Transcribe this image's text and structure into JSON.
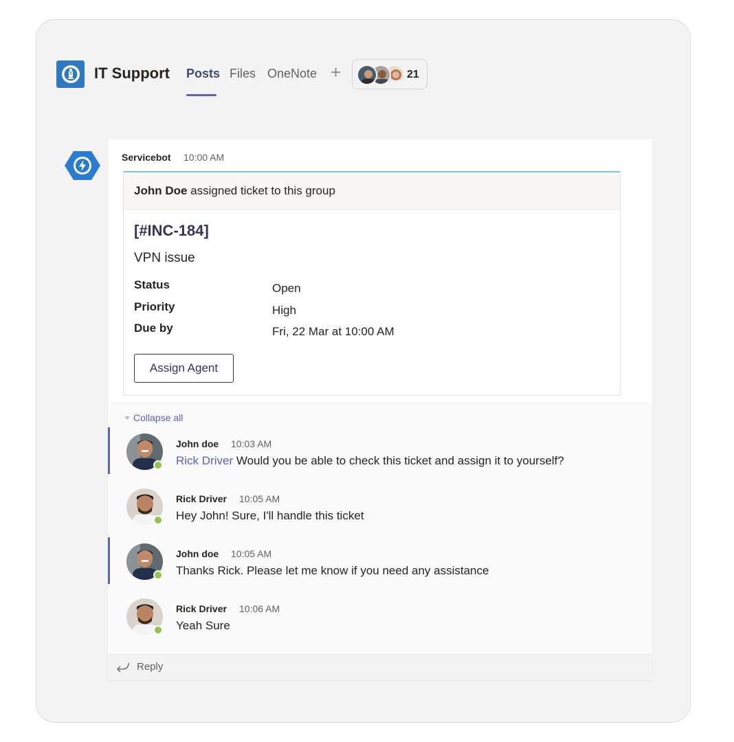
{
  "header": {
    "team_name": "IT Support",
    "tabs": [
      "Posts",
      "Files",
      "OneNote"
    ],
    "active_tab": "Posts",
    "add_tab_icon": "plus-icon",
    "member_count": "21"
  },
  "post": {
    "author": "Servicebot",
    "time": "10:00 AM",
    "card": {
      "banner_actor": "John Doe",
      "banner_text": " assigned ticket to this group",
      "ticket_id": "[#INC-184]",
      "ticket_title": "VPN issue",
      "facts": [
        {
          "label": "Status",
          "value": "Open"
        },
        {
          "label": "Priority",
          "value": "High"
        },
        {
          "label": "Due by",
          "value": "Fri, 22 Mar at 10:00 AM"
        }
      ],
      "action_label": "Assign Agent"
    }
  },
  "replies": {
    "collapse_label": "Collapse all",
    "items": [
      {
        "author": "John doe",
        "time": "10:03 AM",
        "mention": "Rick Driver",
        "text": " Would you be able to check this ticket and assign it to yourself?",
        "status": "online"
      },
      {
        "author": "Rick Driver",
        "time": "10:05 AM",
        "mention": "",
        "text": "Hey John! Sure, I'll handle this ticket",
        "status": "online"
      },
      {
        "author": "John doe",
        "time": "10:05 AM",
        "mention": "",
        "text": "Thanks Rick. Please let me know if you need any assistance",
        "status": "online"
      },
      {
        "author": "Rick Driver",
        "time": "10:06 AM",
        "mention": "",
        "text": "Yeah Sure",
        "status": "online"
      }
    ],
    "reply_label": "Reply"
  },
  "colors": {
    "brand": "#6264a7",
    "ticket_link": "#33345c",
    "mention": "#5b5fc7",
    "card_accent": "#78c7ee",
    "presence": "#92c353",
    "team_logo": "#2f79c2"
  }
}
